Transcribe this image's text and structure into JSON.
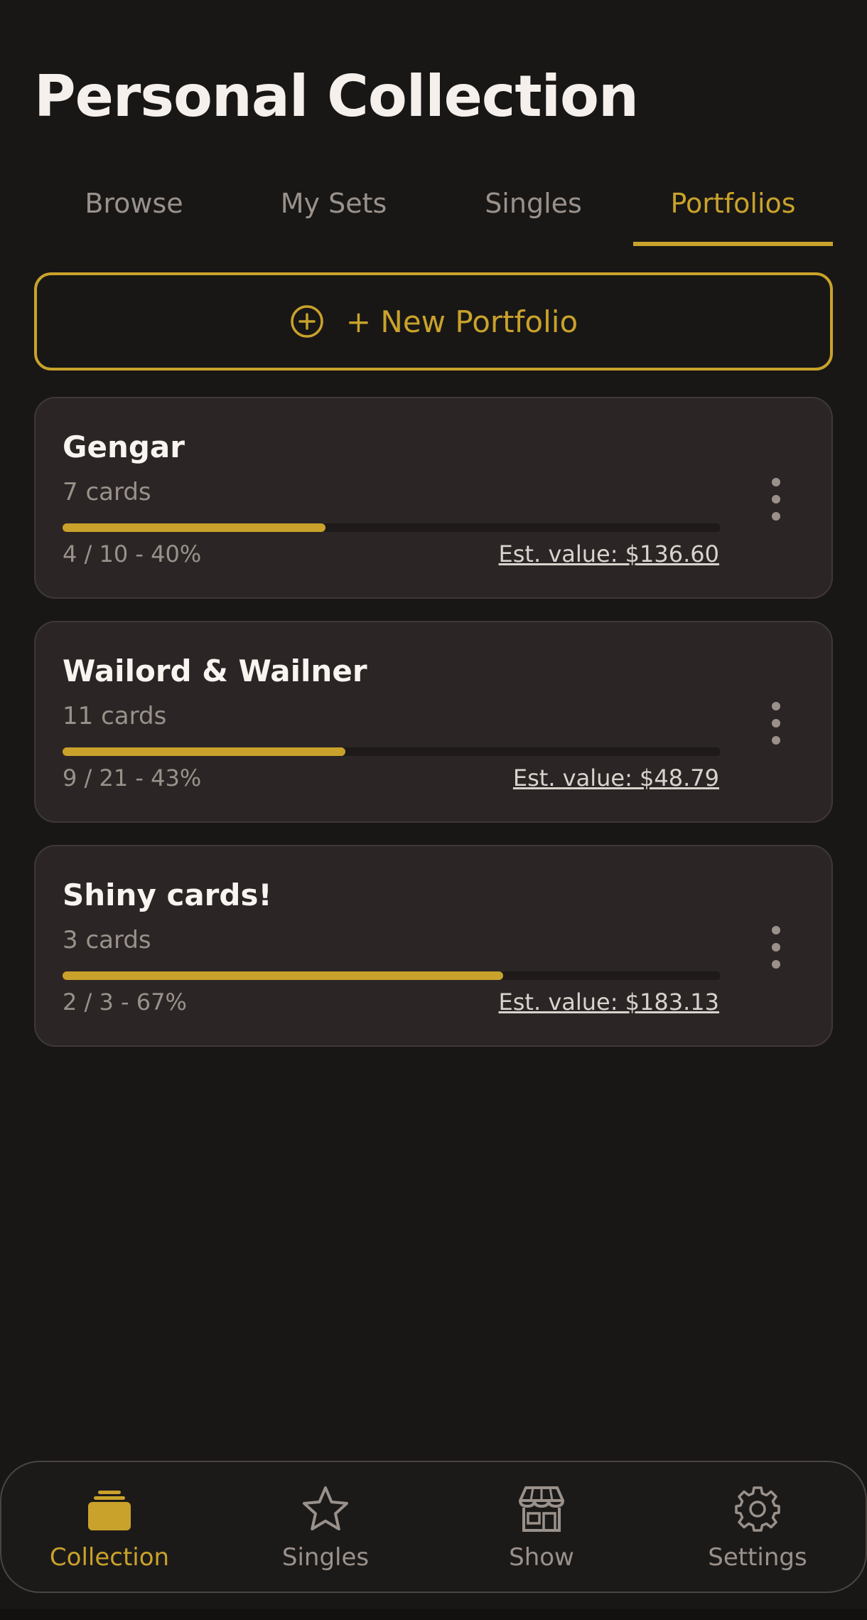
{
  "header": {
    "title": "Personal Collection"
  },
  "tabs": [
    {
      "label": "Browse",
      "active": false
    },
    {
      "label": "My Sets",
      "active": false
    },
    {
      "label": "Singles",
      "active": false
    },
    {
      "label": "Portfolios",
      "active": true
    }
  ],
  "new_portfolio": {
    "label": "+ New Portfolio",
    "icon": "plus-circle-icon"
  },
  "portfolios": [
    {
      "name": "Gengar",
      "cards": "7 cards",
      "progress_text": "4 / 10 - 40%",
      "progress": 0.4,
      "value": "Est. value: $136.60"
    },
    {
      "name": "Wailord & Wailner",
      "cards": "11 cards",
      "progress_text": "9 / 21 - 43%",
      "progress": 0.43,
      "value": "Est. value: $48.79"
    },
    {
      "name": "Shiny cards!",
      "cards": "3 cards",
      "progress_text": "2 / 3 - 67%",
      "progress": 0.67,
      "value": "Est. value: $183.13"
    }
  ],
  "bottom_nav": [
    {
      "label": "Collection",
      "icon": "card-stack-icon",
      "active": true
    },
    {
      "label": "Singles",
      "icon": "star-icon",
      "active": false
    },
    {
      "label": "Show",
      "icon": "storefront-icon",
      "active": false
    },
    {
      "label": "Settings",
      "icon": "gear-icon",
      "active": false
    }
  ],
  "colors": {
    "background": "#181716",
    "accent": "#c9a22b",
    "card": "#2b2625",
    "muted_text": "#9a918b"
  }
}
